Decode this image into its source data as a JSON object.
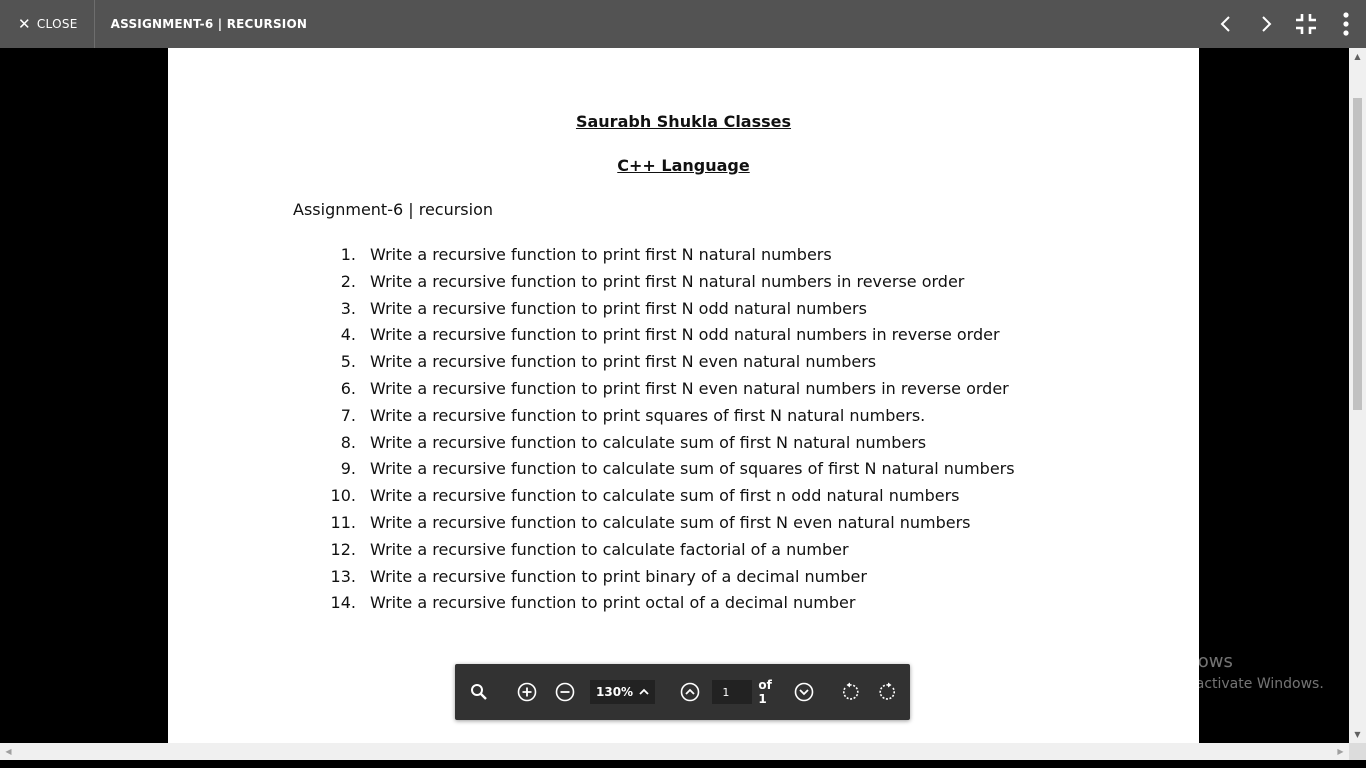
{
  "topbar": {
    "close_label": "CLOSE",
    "title": "ASSIGNMENT-6 | RECURSION"
  },
  "document": {
    "heading1": "Saurabh Shukla Classes",
    "heading2": "C++ Language",
    "subtitle": "Assignment-6 | recursion",
    "questions": [
      {
        "num": "1.",
        "text": "Write a recursive function to print first N natural numbers"
      },
      {
        "num": "2.",
        "text": "Write a recursive function to print first N natural numbers in reverse order"
      },
      {
        "num": "3.",
        "text": "Write a recursive function to print first N odd natural numbers"
      },
      {
        "num": "4.",
        "text": "Write a recursive function to print first N odd natural numbers in reverse order"
      },
      {
        "num": "5.",
        "text": "Write a recursive function to print first N even natural numbers"
      },
      {
        "num": "6.",
        "text": "Write a recursive function to print first N even natural numbers in reverse order"
      },
      {
        "num": "7.",
        "text": "Write a recursive function to print squares of first N natural numbers."
      },
      {
        "num": "8.",
        "text": "Write a recursive function to calculate sum of first N natural numbers"
      },
      {
        "num": "9.",
        "text": "Write a recursive function to calculate sum of squares of first N natural numbers"
      },
      {
        "num": "10.",
        "text": "Write a recursive function to calculate sum of first n odd natural numbers"
      },
      {
        "num": "11.",
        "text": "Write a recursive function to calculate sum of first N even natural numbers"
      },
      {
        "num": "12.",
        "text": "Write a recursive function to calculate factorial of a number"
      },
      {
        "num": "13.",
        "text": "Write a recursive function to print binary of a decimal number"
      },
      {
        "num": "14.",
        "text": "Write a recursive function to print octal of a decimal number"
      }
    ]
  },
  "toolbar": {
    "zoom_value": "130%",
    "page_number": "1",
    "page_of": "of 1"
  },
  "watermark": {
    "title": "Activate Windows",
    "subtitle": "Go to Settings to activate Windows."
  },
  "colors": {
    "topbar_bg": "#535353",
    "toolbar_bg": "#323232",
    "viewer_bg": "#000000",
    "page_bg": "#ffffff"
  },
  "icons": [
    "close-icon",
    "chevron-left-icon",
    "chevron-right-icon",
    "exit-fullscreen-icon",
    "more-vertical-icon",
    "search-icon",
    "zoom-in-icon",
    "zoom-out-icon",
    "chevron-up-icon",
    "previous-page-icon",
    "next-page-icon",
    "rotate-left-icon",
    "rotate-right-icon"
  ]
}
